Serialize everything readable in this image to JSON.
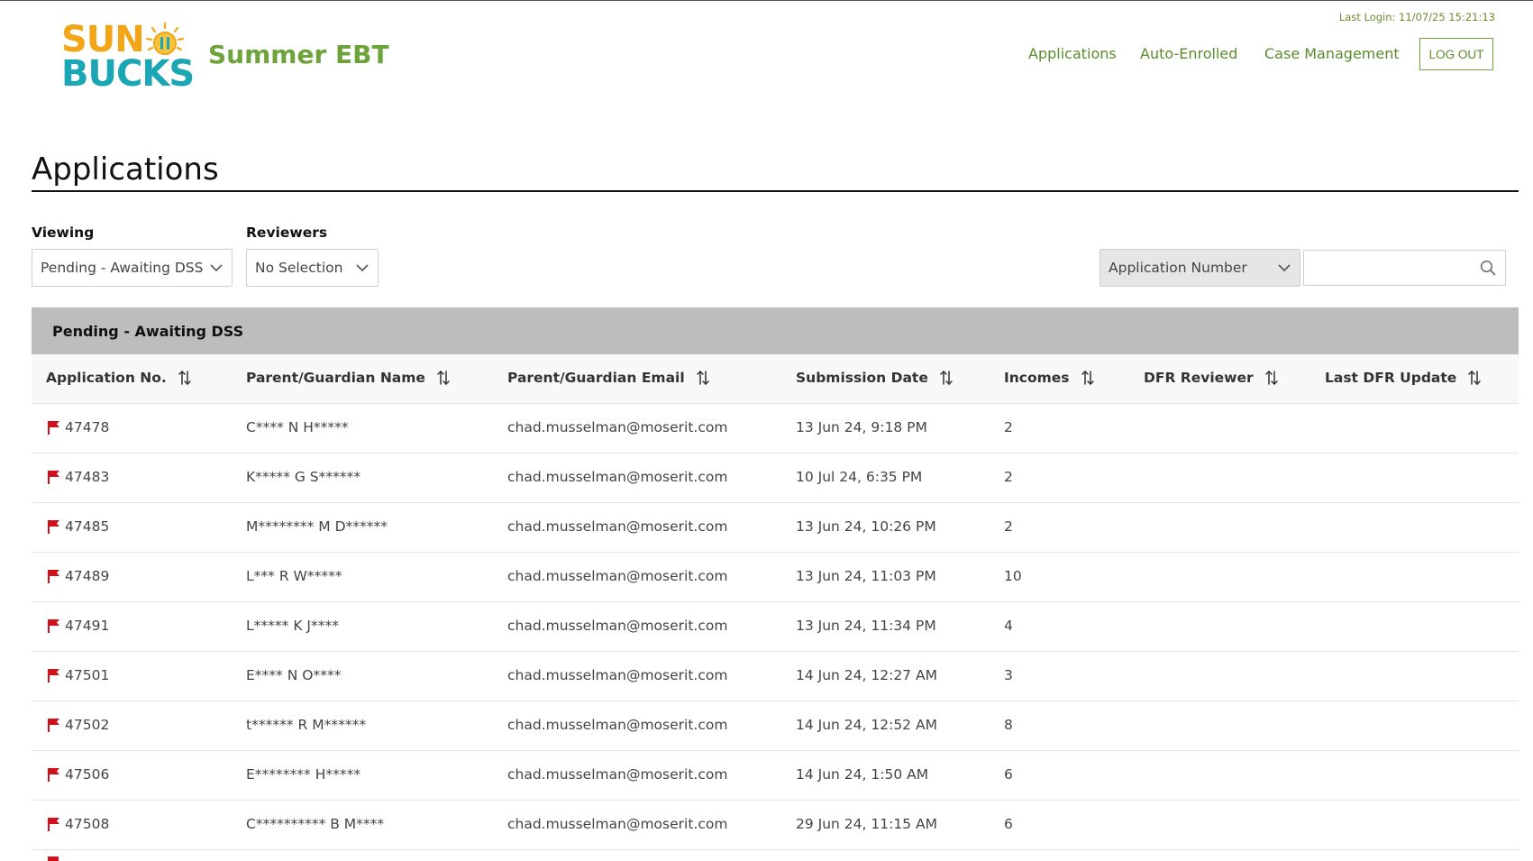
{
  "header": {
    "logo_line1": "SUN",
    "logo_line2": "BUCKS",
    "brand_name": "Summer EBT",
    "last_login": "Last Login: 11/07/25 15:21:13",
    "nav": [
      "Applications",
      "Auto-Enrolled",
      "Case Management"
    ],
    "logout_label": "LOG OUT"
  },
  "page": {
    "title": "Applications"
  },
  "filters": {
    "viewing_label": "Viewing",
    "viewing_value": "Pending - Awaiting DSS",
    "reviewers_label": "Reviewers",
    "reviewers_value": "No Selection",
    "search_field_value": "Application Number",
    "search_input_value": ""
  },
  "table": {
    "section_title": "Pending - Awaiting DSS",
    "columns": [
      "Application No.",
      "Parent/Guardian Name",
      "Parent/Guardian Email",
      "Submission Date",
      "Incomes",
      "DFR Reviewer",
      "Last DFR Update"
    ],
    "rows": [
      {
        "app_no": "47478",
        "name": "C**** N H*****",
        "email": "chad.musselman@moserit.com",
        "date": "13 Jun 24, 9:18 PM",
        "incomes": "2",
        "reviewer": "",
        "last_update": ""
      },
      {
        "app_no": "47483",
        "name": "K***** G S******",
        "email": "chad.musselman@moserit.com",
        "date": "10 Jul 24, 6:35 PM",
        "incomes": "2",
        "reviewer": "",
        "last_update": ""
      },
      {
        "app_no": "47485",
        "name": "M******** M D******",
        "email": "chad.musselman@moserit.com",
        "date": "13 Jun 24, 10:26 PM",
        "incomes": "2",
        "reviewer": "",
        "last_update": ""
      },
      {
        "app_no": "47489",
        "name": "L*** R W*****",
        "email": "chad.musselman@moserit.com",
        "date": "13 Jun 24, 11:03 PM",
        "incomes": "10",
        "reviewer": "",
        "last_update": ""
      },
      {
        "app_no": "47491",
        "name": "L***** K J****",
        "email": "chad.musselman@moserit.com",
        "date": "13 Jun 24, 11:34 PM",
        "incomes": "4",
        "reviewer": "",
        "last_update": ""
      },
      {
        "app_no": "47501",
        "name": "E**** N O****",
        "email": "chad.musselman@moserit.com",
        "date": "14 Jun 24, 12:27 AM",
        "incomes": "3",
        "reviewer": "",
        "last_update": ""
      },
      {
        "app_no": "47502",
        "name": "t****** R M******",
        "email": "chad.musselman@moserit.com",
        "date": "14 Jun 24, 12:52 AM",
        "incomes": "8",
        "reviewer": "",
        "last_update": ""
      },
      {
        "app_no": "47506",
        "name": "E******** H*****",
        "email": "chad.musselman@moserit.com",
        "date": "14 Jun 24, 1:50 AM",
        "incomes": "6",
        "reviewer": "",
        "last_update": ""
      },
      {
        "app_no": "47508",
        "name": "C********** B M****",
        "email": "chad.musselman@moserit.com",
        "date": "29 Jun 24, 11:15 AM",
        "incomes": "6",
        "reviewer": "",
        "last_update": ""
      }
    ]
  },
  "icons": {
    "flag": "flag-icon",
    "sort": "sort-arrows-icon",
    "chevron": "chevron-down-icon",
    "search": "search-icon"
  },
  "colors": {
    "brand_green": "#6da33a",
    "nav_green": "#5b8c2b",
    "logo_orange": "#f2a517",
    "logo_teal": "#1aa6b4",
    "flag_red": "#d0101b",
    "table_header_bar": "#bdbdbd"
  }
}
